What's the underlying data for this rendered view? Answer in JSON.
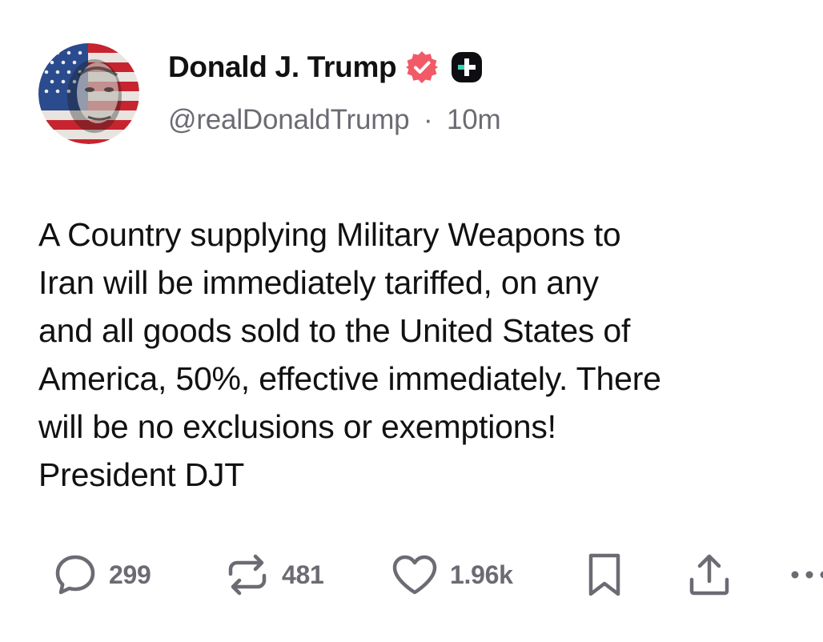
{
  "post": {
    "author": {
      "display_name": "Donald J. Trump",
      "handle": "@realDonaldTrump",
      "separator": "·",
      "time_ago": "10m",
      "verified_icon": "verified-badge-icon",
      "extra_badge_icon": "plus-badge-icon"
    },
    "body_lines": [
      "A Country supplying Military Weapons to",
      "Iran will be immediately tariffed, on any",
      "and all goods sold to the United States of",
      "America, 50%, effective immediately. There",
      "will be no exclusions or exemptions!",
      "President DJT"
    ],
    "actions": {
      "reply": {
        "icon": "comment-icon",
        "count": "299"
      },
      "retruth": {
        "icon": "repost-icon",
        "count": "481"
      },
      "like": {
        "icon": "heart-icon",
        "count": "1.96k"
      },
      "bookmark": {
        "icon": "bookmark-icon"
      },
      "share": {
        "icon": "share-icon"
      },
      "more": {
        "icon": "more-icon"
      }
    }
  },
  "colors": {
    "text": "#111111",
    "muted": "#6b6b73",
    "verified": "#f15a66",
    "badge_dark": "#0e0e12",
    "badge_plus": "#2fd5b4"
  }
}
